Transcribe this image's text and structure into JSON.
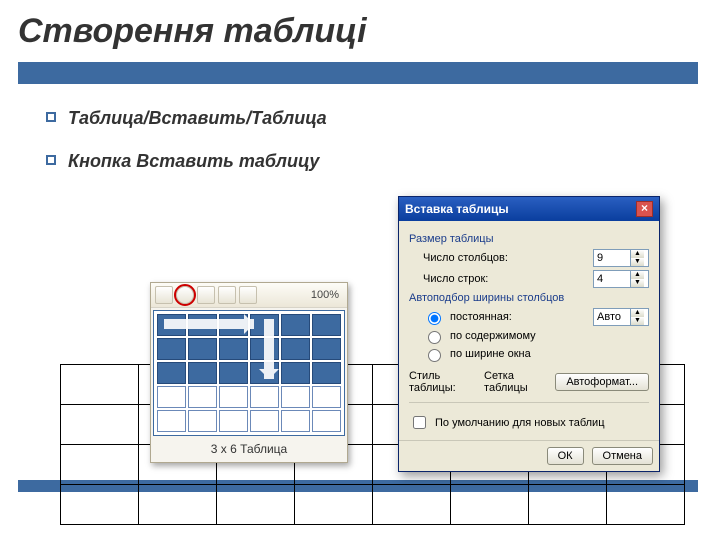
{
  "title": "Створення таблиці",
  "bullets": [
    "Таблица/Вставить/Таблица",
    "Кнопка Вставить таблицу"
  ],
  "picker": {
    "zoom": "100%",
    "caption": "3 x 6 Таблица",
    "rows": 5,
    "cols": 6,
    "sel_rows": 3,
    "sel_cols": 6
  },
  "dialog": {
    "title": "Вставка таблицы",
    "group_size": "Размер таблицы",
    "cols_label": "Число столбцов:",
    "cols_value": "9",
    "rows_label": "Число строк:",
    "rows_value": "4",
    "group_autofit": "Автоподбор ширины столбцов",
    "radio_fixed": "постоянная:",
    "radio_content": "по содержимому",
    "radio_window": "по ширине окна",
    "fixed_value": "Авто",
    "style_label": "Стиль таблицы:",
    "style_name": "Сетка таблицы",
    "autoformat": "Автоформат...",
    "default_check": "По умолчанию для новых таблиц",
    "ok": "ОК",
    "cancel": "Отмена"
  },
  "bg_grid": {
    "rows": 4,
    "cols": 8
  }
}
